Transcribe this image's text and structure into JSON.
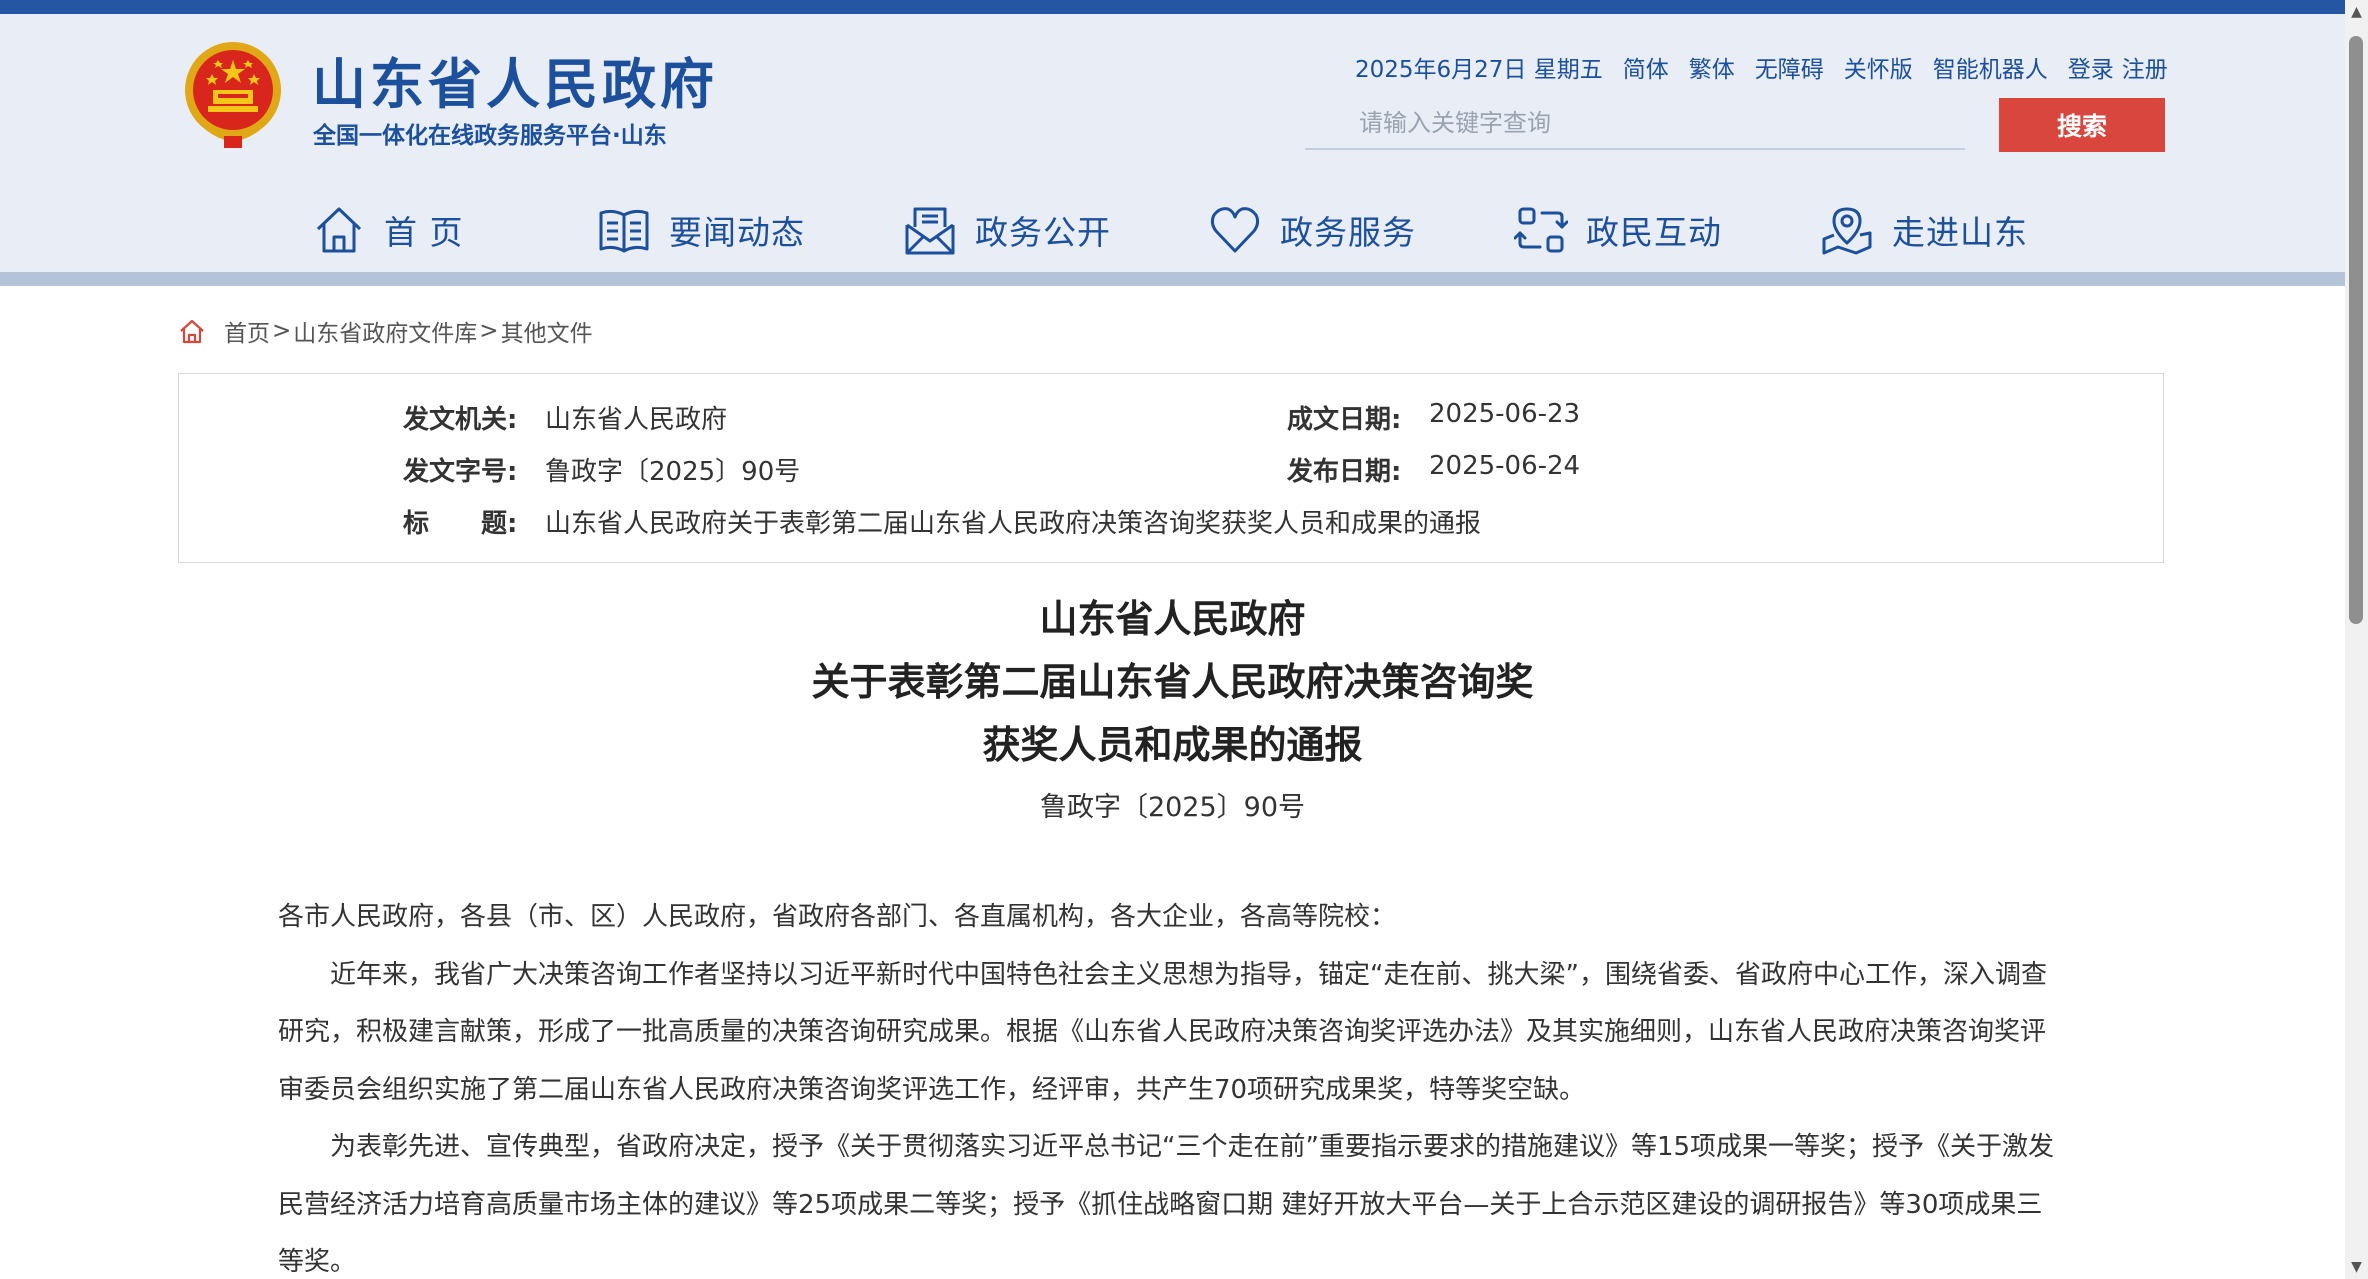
{
  "header": {
    "site_title": "山东省人民政府",
    "site_subtitle": "全国一体化在线政务服务平台·山东",
    "date": "2025年6月27日 星期五",
    "links": [
      "简体",
      "繁体",
      "无障碍",
      "关怀版",
      "智能机器人",
      "登录",
      "注册"
    ],
    "search_placeholder": "请输入关键字查询",
    "search_button": "搜索",
    "brand_color": "#1c4f9c",
    "accent_color": "#d9463d"
  },
  "nav": {
    "items": [
      {
        "label": "首 页",
        "icon": "home-icon"
      },
      {
        "label": "要闻动态",
        "icon": "book-icon"
      },
      {
        "label": "政务公开",
        "icon": "envelope-document-icon"
      },
      {
        "label": "政务服务",
        "icon": "heart-icon"
      },
      {
        "label": "政民互动",
        "icon": "interaction-arrows-icon"
      },
      {
        "label": "走进山东",
        "icon": "map-pin-icon"
      }
    ]
  },
  "breadcrumb": {
    "items": [
      "首页",
      "山东省政府文件库",
      "其他文件"
    ],
    "separator": ">"
  },
  "info": {
    "issuer_label": "发文机关:",
    "issuer": "山东省人民政府",
    "doc_no_label": "发文字号:",
    "doc_no": "鲁政字〔2025〕90号",
    "title_label": "标　　题:",
    "title": "山东省人民政府关于表彰第二届山东省人民政府决策咨询奖获奖人员和成果的通报",
    "written_date_label": "成文日期:",
    "written_date": "2025-06-23",
    "publish_date_label": "发布日期:",
    "publish_date": "2025-06-24"
  },
  "document": {
    "title_lines": [
      "山东省人民政府",
      "关于表彰第二届山东省人民政府决策咨询奖",
      "获奖人员和成果的通报"
    ],
    "number": "鲁政字〔2025〕90号",
    "salutation": "各市人民政府，各县（市、区）人民政府，省政府各部门、各直属机构，各大企业，各高等院校：",
    "paragraphs": [
      "近年来，我省广大决策咨询工作者坚持以习近平新时代中国特色社会主义思想为指导，锚定“走在前、挑大梁”，围绕省委、省政府中心工作，深入调查研究，积极建言献策，形成了一批高质量的决策咨询研究成果。根据《山东省人民政府决策咨询奖评选办法》及其实施细则，山东省人民政府决策咨询奖评审委员会组织实施了第二届山东省人民政府决策咨询奖评选工作，经评审，共产生70项研究成果奖，特等奖空缺。",
      "为表彰先进、宣传典型，省政府决定，授予《关于贯彻落实习近平总书记“三个走在前”重要指示要求的措施建议》等15项成果一等奖；授予《关于激发民营经济活力培育高质量市场主体的建议》等25项成果二等奖；授予《抓住战略窗口期 建好开放大平台—关于上合示范区建设的调研报告》等30项成果三等奖。"
    ]
  }
}
